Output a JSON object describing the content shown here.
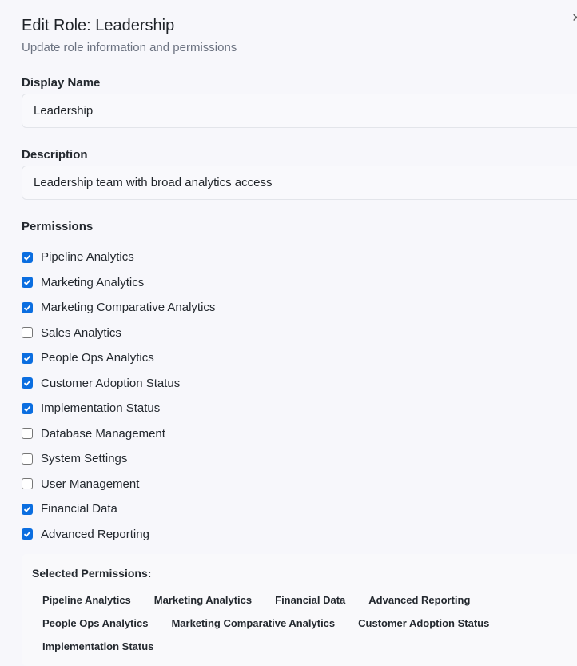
{
  "dialog": {
    "title": "Edit Role: Leadership",
    "subtitle": "Update role information and permissions",
    "close_label": "×"
  },
  "form": {
    "display_name_label": "Display Name",
    "display_name_value": "Leadership",
    "description_label": "Description",
    "description_value": "Leadership team with broad analytics access",
    "permissions_label": "Permissions"
  },
  "permissions": [
    {
      "label": "Pipeline Analytics",
      "checked": true
    },
    {
      "label": "Marketing Analytics",
      "checked": true
    },
    {
      "label": "Marketing Comparative Analytics",
      "checked": true
    },
    {
      "label": "Sales Analytics",
      "checked": false
    },
    {
      "label": "People Ops Analytics",
      "checked": true
    },
    {
      "label": "Customer Adoption Status",
      "checked": true
    },
    {
      "label": "Implementation Status",
      "checked": true
    },
    {
      "label": "Database Management",
      "checked": false
    },
    {
      "label": "System Settings",
      "checked": false
    },
    {
      "label": "User Management",
      "checked": false
    },
    {
      "label": "Financial Data",
      "checked": true
    },
    {
      "label": "Advanced Reporting",
      "checked": true
    }
  ],
  "selected": {
    "title": "Selected Permissions:",
    "items": [
      "Pipeline Analytics",
      "Marketing Analytics",
      "Financial Data",
      "Advanced Reporting",
      "People Ops Analytics",
      "Marketing Comparative Analytics",
      "Customer Adoption Status",
      "Implementation Status"
    ]
  },
  "colors": {
    "accent": "#0b6ee0"
  }
}
